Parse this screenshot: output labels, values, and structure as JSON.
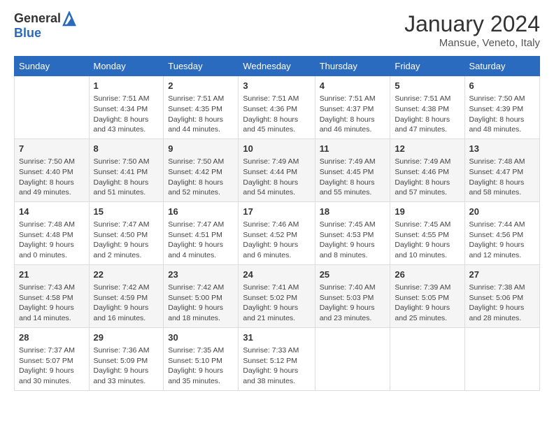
{
  "logo": {
    "general": "General",
    "blue": "Blue"
  },
  "header": {
    "month_year": "January 2024",
    "location": "Mansue, Veneto, Italy"
  },
  "days_of_week": [
    "Sunday",
    "Monday",
    "Tuesday",
    "Wednesday",
    "Thursday",
    "Friday",
    "Saturday"
  ],
  "weeks": [
    [
      {
        "day": "",
        "sunrise": "",
        "sunset": "",
        "daylight": ""
      },
      {
        "day": "1",
        "sunrise": "Sunrise: 7:51 AM",
        "sunset": "Sunset: 4:34 PM",
        "daylight": "Daylight: 8 hours and 43 minutes."
      },
      {
        "day": "2",
        "sunrise": "Sunrise: 7:51 AM",
        "sunset": "Sunset: 4:35 PM",
        "daylight": "Daylight: 8 hours and 44 minutes."
      },
      {
        "day": "3",
        "sunrise": "Sunrise: 7:51 AM",
        "sunset": "Sunset: 4:36 PM",
        "daylight": "Daylight: 8 hours and 45 minutes."
      },
      {
        "day": "4",
        "sunrise": "Sunrise: 7:51 AM",
        "sunset": "Sunset: 4:37 PM",
        "daylight": "Daylight: 8 hours and 46 minutes."
      },
      {
        "day": "5",
        "sunrise": "Sunrise: 7:51 AM",
        "sunset": "Sunset: 4:38 PM",
        "daylight": "Daylight: 8 hours and 47 minutes."
      },
      {
        "day": "6",
        "sunrise": "Sunrise: 7:50 AM",
        "sunset": "Sunset: 4:39 PM",
        "daylight": "Daylight: 8 hours and 48 minutes."
      }
    ],
    [
      {
        "day": "7",
        "sunrise": "Sunrise: 7:50 AM",
        "sunset": "Sunset: 4:40 PM",
        "daylight": "Daylight: 8 hours and 49 minutes."
      },
      {
        "day": "8",
        "sunrise": "Sunrise: 7:50 AM",
        "sunset": "Sunset: 4:41 PM",
        "daylight": "Daylight: 8 hours and 51 minutes."
      },
      {
        "day": "9",
        "sunrise": "Sunrise: 7:50 AM",
        "sunset": "Sunset: 4:42 PM",
        "daylight": "Daylight: 8 hours and 52 minutes."
      },
      {
        "day": "10",
        "sunrise": "Sunrise: 7:49 AM",
        "sunset": "Sunset: 4:44 PM",
        "daylight": "Daylight: 8 hours and 54 minutes."
      },
      {
        "day": "11",
        "sunrise": "Sunrise: 7:49 AM",
        "sunset": "Sunset: 4:45 PM",
        "daylight": "Daylight: 8 hours and 55 minutes."
      },
      {
        "day": "12",
        "sunrise": "Sunrise: 7:49 AM",
        "sunset": "Sunset: 4:46 PM",
        "daylight": "Daylight: 8 hours and 57 minutes."
      },
      {
        "day": "13",
        "sunrise": "Sunrise: 7:48 AM",
        "sunset": "Sunset: 4:47 PM",
        "daylight": "Daylight: 8 hours and 58 minutes."
      }
    ],
    [
      {
        "day": "14",
        "sunrise": "Sunrise: 7:48 AM",
        "sunset": "Sunset: 4:48 PM",
        "daylight": "Daylight: 9 hours and 0 minutes."
      },
      {
        "day": "15",
        "sunrise": "Sunrise: 7:47 AM",
        "sunset": "Sunset: 4:50 PM",
        "daylight": "Daylight: 9 hours and 2 minutes."
      },
      {
        "day": "16",
        "sunrise": "Sunrise: 7:47 AM",
        "sunset": "Sunset: 4:51 PM",
        "daylight": "Daylight: 9 hours and 4 minutes."
      },
      {
        "day": "17",
        "sunrise": "Sunrise: 7:46 AM",
        "sunset": "Sunset: 4:52 PM",
        "daylight": "Daylight: 9 hours and 6 minutes."
      },
      {
        "day": "18",
        "sunrise": "Sunrise: 7:45 AM",
        "sunset": "Sunset: 4:53 PM",
        "daylight": "Daylight: 9 hours and 8 minutes."
      },
      {
        "day": "19",
        "sunrise": "Sunrise: 7:45 AM",
        "sunset": "Sunset: 4:55 PM",
        "daylight": "Daylight: 9 hours and 10 minutes."
      },
      {
        "day": "20",
        "sunrise": "Sunrise: 7:44 AM",
        "sunset": "Sunset: 4:56 PM",
        "daylight": "Daylight: 9 hours and 12 minutes."
      }
    ],
    [
      {
        "day": "21",
        "sunrise": "Sunrise: 7:43 AM",
        "sunset": "Sunset: 4:58 PM",
        "daylight": "Daylight: 9 hours and 14 minutes."
      },
      {
        "day": "22",
        "sunrise": "Sunrise: 7:42 AM",
        "sunset": "Sunset: 4:59 PM",
        "daylight": "Daylight: 9 hours and 16 minutes."
      },
      {
        "day": "23",
        "sunrise": "Sunrise: 7:42 AM",
        "sunset": "Sunset: 5:00 PM",
        "daylight": "Daylight: 9 hours and 18 minutes."
      },
      {
        "day": "24",
        "sunrise": "Sunrise: 7:41 AM",
        "sunset": "Sunset: 5:02 PM",
        "daylight": "Daylight: 9 hours and 21 minutes."
      },
      {
        "day": "25",
        "sunrise": "Sunrise: 7:40 AM",
        "sunset": "Sunset: 5:03 PM",
        "daylight": "Daylight: 9 hours and 23 minutes."
      },
      {
        "day": "26",
        "sunrise": "Sunrise: 7:39 AM",
        "sunset": "Sunset: 5:05 PM",
        "daylight": "Daylight: 9 hours and 25 minutes."
      },
      {
        "day": "27",
        "sunrise": "Sunrise: 7:38 AM",
        "sunset": "Sunset: 5:06 PM",
        "daylight": "Daylight: 9 hours and 28 minutes."
      }
    ],
    [
      {
        "day": "28",
        "sunrise": "Sunrise: 7:37 AM",
        "sunset": "Sunset: 5:07 PM",
        "daylight": "Daylight: 9 hours and 30 minutes."
      },
      {
        "day": "29",
        "sunrise": "Sunrise: 7:36 AM",
        "sunset": "Sunset: 5:09 PM",
        "daylight": "Daylight: 9 hours and 33 minutes."
      },
      {
        "day": "30",
        "sunrise": "Sunrise: 7:35 AM",
        "sunset": "Sunset: 5:10 PM",
        "daylight": "Daylight: 9 hours and 35 minutes."
      },
      {
        "day": "31",
        "sunrise": "Sunrise: 7:33 AM",
        "sunset": "Sunset: 5:12 PM",
        "daylight": "Daylight: 9 hours and 38 minutes."
      },
      {
        "day": "",
        "sunrise": "",
        "sunset": "",
        "daylight": ""
      },
      {
        "day": "",
        "sunrise": "",
        "sunset": "",
        "daylight": ""
      },
      {
        "day": "",
        "sunrise": "",
        "sunset": "",
        "daylight": ""
      }
    ]
  ]
}
